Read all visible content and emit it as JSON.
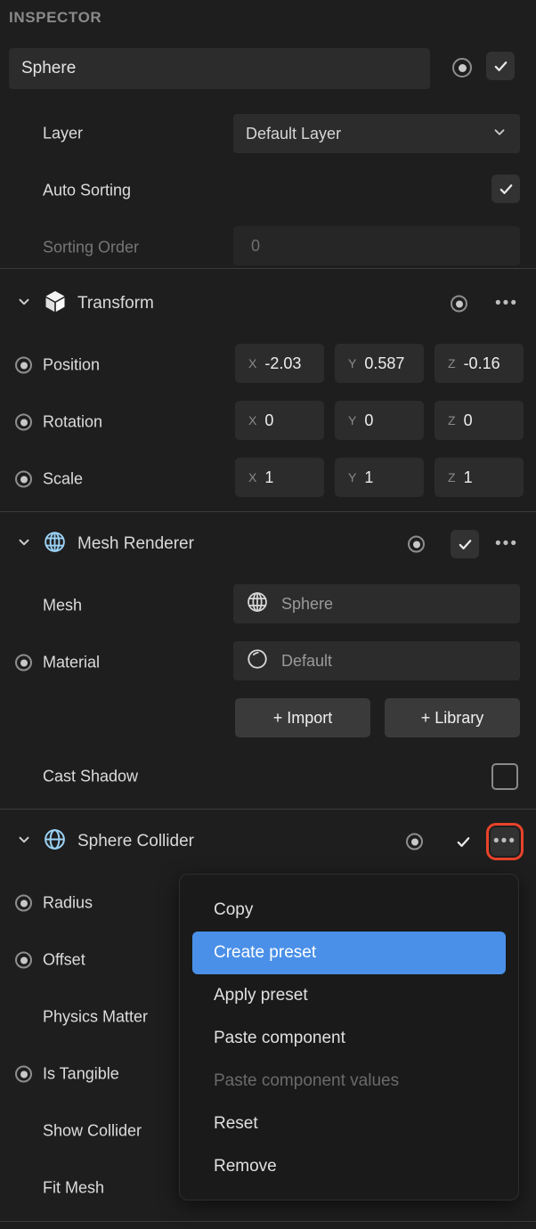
{
  "header": {
    "title": "INSPECTOR"
  },
  "object": {
    "name": "Sphere",
    "record_icon": "record-icon",
    "enabled_icon": "check-icon"
  },
  "properties": {
    "layer": {
      "label": "Layer",
      "value": "Default Layer",
      "chevron": "chevron-down-icon"
    },
    "auto_sorting": {
      "label": "Auto Sorting",
      "checked_icon": "check-icon"
    },
    "sorting_order": {
      "label": "Sorting Order",
      "value": "0"
    }
  },
  "transform": {
    "title": "Transform",
    "icon": "cube-icon",
    "chevron": "chevron-down-icon",
    "record_icon": "record-icon",
    "more_icon": "ellipsis-icon",
    "rows": [
      {
        "label": "Position",
        "axes": [
          "X",
          "Y",
          "Z"
        ],
        "values": [
          "-2.03",
          "0.587",
          "-0.16"
        ]
      },
      {
        "label": "Rotation",
        "axes": [
          "X",
          "Y",
          "Z"
        ],
        "values": [
          "0",
          "0",
          "0"
        ]
      },
      {
        "label": "Scale",
        "axes": [
          "X",
          "Y",
          "Z"
        ],
        "values": [
          "1",
          "1",
          "1"
        ]
      }
    ]
  },
  "mesh_renderer": {
    "title": "Mesh Renderer",
    "icon": "globe-icon",
    "chevron": "chevron-down-icon",
    "record_icon": "record-icon",
    "enabled_icon": "check-icon",
    "more_icon": "ellipsis-icon",
    "mesh": {
      "label": "Mesh",
      "value": "Sphere",
      "icon": "globe-icon"
    },
    "material": {
      "label": "Material",
      "value": "Default",
      "icon": "material-sphere-icon"
    },
    "import_button": "+ Import",
    "library_button": "+ Library",
    "cast_shadow": {
      "label": "Cast Shadow",
      "checked": false
    }
  },
  "sphere_collider": {
    "title": "Sphere Collider",
    "icon": "collider-sphere-icon",
    "chevron": "chevron-down-icon",
    "record_icon": "record-icon",
    "enabled_icon": "check-icon",
    "more_icon": "ellipsis-icon",
    "more_highlight_color": "#e8432a",
    "rows": [
      {
        "label": "Radius",
        "has_record": true
      },
      {
        "label": "Offset",
        "has_record": true
      },
      {
        "label": "Physics Matter",
        "has_record": false
      },
      {
        "label": "Is Tangible",
        "has_record": true
      },
      {
        "label": "Show Collider",
        "has_record": false
      },
      {
        "label": "Fit Mesh",
        "has_record": false
      }
    ]
  },
  "context_menu": {
    "highlight_color": "#4a90e8",
    "items": [
      {
        "label": "Copy",
        "state": "normal"
      },
      {
        "label": "Create preset",
        "state": "selected"
      },
      {
        "label": "Apply preset",
        "state": "normal"
      },
      {
        "label": "Paste component",
        "state": "normal"
      },
      {
        "label": "Paste component values",
        "state": "disabled"
      },
      {
        "label": "Reset",
        "state": "normal"
      },
      {
        "label": "Remove",
        "state": "normal"
      }
    ]
  }
}
